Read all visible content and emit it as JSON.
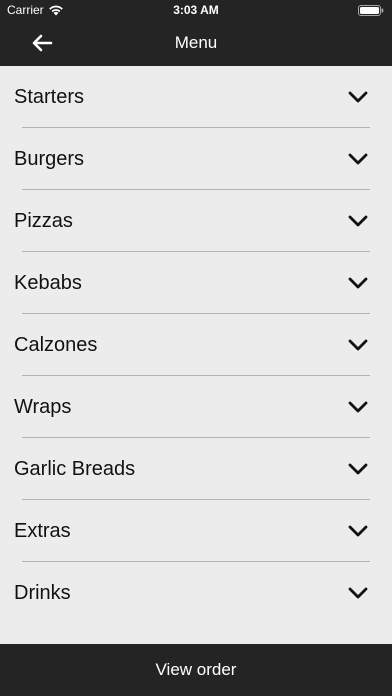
{
  "status_bar": {
    "carrier": "Carrier",
    "time": "3:03 AM",
    "wifi_icon": "wifi-icon",
    "battery_icon": "battery-icon"
  },
  "nav": {
    "title": "Menu",
    "back_icon": "arrow-left-icon"
  },
  "menu": {
    "items": [
      {
        "label": "Starters"
      },
      {
        "label": "Burgers"
      },
      {
        "label": "Pizzas"
      },
      {
        "label": "Kebabs"
      },
      {
        "label": "Calzones"
      },
      {
        "label": "Wraps"
      },
      {
        "label": "Garlic Breads"
      },
      {
        "label": "Extras"
      },
      {
        "label": "Drinks"
      }
    ],
    "expand_icon": "chevron-down-icon"
  },
  "bottom": {
    "view_order_label": "View order"
  },
  "colors": {
    "bar_background": "#242424",
    "list_background": "#ececec",
    "text": "#111111",
    "divider": "#b4b4b4"
  }
}
